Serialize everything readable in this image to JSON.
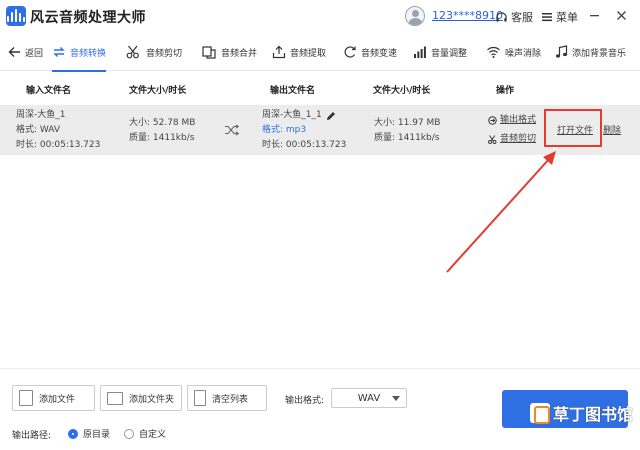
{
  "app": {
    "title": "风云音频处理大师"
  },
  "account": {
    "phone": "123****8910",
    "service_label": "客服",
    "menu_label": "菜单"
  },
  "toolbar": {
    "back_label": "返回",
    "tabs": [
      "音频转换",
      "音频剪切",
      "音频合并",
      "音频提取",
      "音频变速",
      "音量调整",
      "噪声消除",
      "添加背景音乐"
    ]
  },
  "table": {
    "headers": [
      "输入文件名",
      "文件大小/时长",
      "输出文件名",
      "文件大小/时长",
      "操作"
    ],
    "rows": [
      {
        "input_name": "周深-大鱼_1",
        "input_format": "格式:  WAV",
        "input_duration": "时长:  00:05:13.723",
        "input_size": "大小:  52.78 MB",
        "input_quality": "质量:  1411kb/s",
        "output_name": "周深-大鱼_1_1",
        "output_format": "格式:  mp3",
        "output_duration": "时长:  00:05:13.723",
        "output_size": "大小:  11.97 MB",
        "output_quality": "质量:  1411kb/s",
        "action_output_format": "输出格式",
        "action_audio_cut": "音频剪切",
        "action_open_file": "打开文件",
        "action_delete": "删除"
      }
    ]
  },
  "bottom": {
    "add_file": "添加文件",
    "add_folder": "添加文件夹",
    "clear_list": "清空列表",
    "output_format_label": "输出格式:",
    "output_format_value": "WAV",
    "output_path_label": "输出路径:",
    "radio_original": "原目录",
    "radio_custom": "自定义",
    "radio_selected": "原目录"
  },
  "watermark": {
    "text": "草丁图书馆"
  },
  "colors": {
    "accent": "#2f6fe4",
    "annotation": "#e53a2e",
    "row_bg": "#ececec"
  }
}
